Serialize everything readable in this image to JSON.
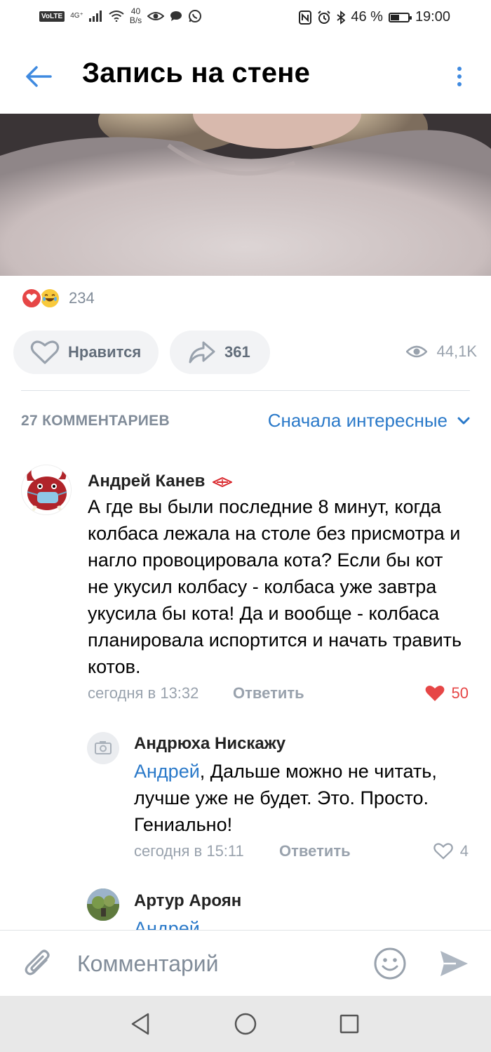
{
  "status_bar": {
    "volte": "VoLTE",
    "network": "4G⁺",
    "speed_value": "40",
    "speed_unit": "B/s",
    "battery_percent": "46 %",
    "battery_level": 0.46,
    "time": "19:00"
  },
  "header": {
    "title": "Запись на стене",
    "back_icon": "arrow-left-icon",
    "menu_icon": "more-vertical-icon"
  },
  "post": {
    "reactions_count": "234",
    "reaction_icons": [
      "heart-reaction-icon",
      "laughing-face-reaction-icon"
    ],
    "like_label": "Нравится",
    "share_count": "361",
    "views_count": "44,1K"
  },
  "comments_section": {
    "count_label": "27 КОММЕНТАРИЕВ",
    "sort_label": "Сначала интересные"
  },
  "comments": [
    {
      "author": "Андрей Канев",
      "text": "А где вы были последние 8 минут, когда колбаса лежала на столе без присмотра и нагло провоцировала кота? Если бы кот не укусил колбасу - колбаса уже завтра укусила бы кота! Да и вообще - колбаса планировала испортится и начать травить котов.",
      "time": "сегодня в 13:32",
      "reply_label": "Ответить",
      "likes": "50",
      "liked": true
    },
    {
      "author": "Андрюха Нискажу",
      "mention": "Андрей",
      "text": ", Дальше можно не читать, лучше уже не будет. Это. Просто. Гениально!",
      "time": "сегодня в 15:11",
      "reply_label": "Ответить",
      "likes": "4",
      "liked": false
    },
    {
      "author": "Артур Ароян",
      "mention": "Андрей"
    }
  ],
  "comment_bar": {
    "placeholder": "Комментарий"
  },
  "colors": {
    "accent": "#2a79c9",
    "icon_blue": "#3f8ae0",
    "like_red": "#e64646",
    "secondary_text": "#818c99",
    "pill_bg": "#f2f3f5"
  }
}
